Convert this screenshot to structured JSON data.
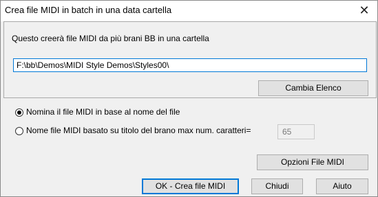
{
  "window": {
    "title": "Crea file MIDI in batch in una data cartella",
    "close_label": "✕"
  },
  "description": "Questo creerà file MIDI da più brani BB in una cartella",
  "folder_path": "F:\\bb\\Demos\\MIDI Style Demos\\Styles00\\",
  "buttons": {
    "change_list": "Cambia Elenco",
    "midi_options": "Opzioni File MIDI",
    "ok": "OK - Crea file MIDI",
    "close": "Chiudi",
    "help": "Aiuto"
  },
  "options": {
    "by_filename": {
      "label": "Nomina il file MIDI in base al nome del file",
      "selected": true
    },
    "by_title": {
      "label": "Nome file MIDI basato su titolo del brano  max num. caratteri=",
      "selected": false
    }
  },
  "max_chars": "65"
}
